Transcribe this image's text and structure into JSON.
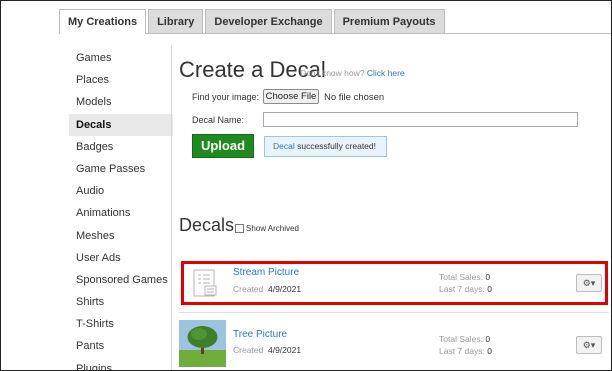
{
  "tabs": [
    "My Creations",
    "Library",
    "Developer Exchange",
    "Premium Payouts"
  ],
  "sidebar": {
    "items": [
      "Games",
      "Places",
      "Models",
      "Decals",
      "Badges",
      "Game Passes",
      "Audio",
      "Animations",
      "Meshes",
      "User Ads",
      "Sponsored Games",
      "Shirts",
      "T-Shirts",
      "Pants",
      "Plugins"
    ],
    "active": "Decals"
  },
  "create": {
    "title": "Create a Decal",
    "hint": "Don't know how?",
    "hint_link": "Click here",
    "find_label": "Find your image:",
    "choose_button": "Choose File",
    "no_file": "No file chosen",
    "name_label": "Decal Name:",
    "name_value": "",
    "upload_button": "Upload",
    "success_highlight": "Decal",
    "success_rest": " successfully created!"
  },
  "decals": {
    "title": "Decals",
    "show_archived": "Show Archived",
    "items": [
      {
        "name": "Stream Picture",
        "created_label": "Created",
        "created_date": "4/9/2021",
        "total_label": "Total Sales:",
        "total_value": "0",
        "last_label": "Last 7 days:",
        "last_value": "0"
      },
      {
        "name": "Tree Picture",
        "created_label": "Created",
        "created_date": "4/9/2021",
        "total_label": "Total Sales:",
        "total_value": "0",
        "last_label": "Last 7 days:",
        "last_value": "0"
      }
    ]
  },
  "icons": {
    "gear": "gear-icon",
    "caret": "caret-down-icon",
    "placeholder": "image-placeholder-icon"
  },
  "colors": {
    "link": "#2a7ab8",
    "upload": "#1f8a1f",
    "highlight": "#e00000",
    "success_bg": "#e8f3fb"
  }
}
